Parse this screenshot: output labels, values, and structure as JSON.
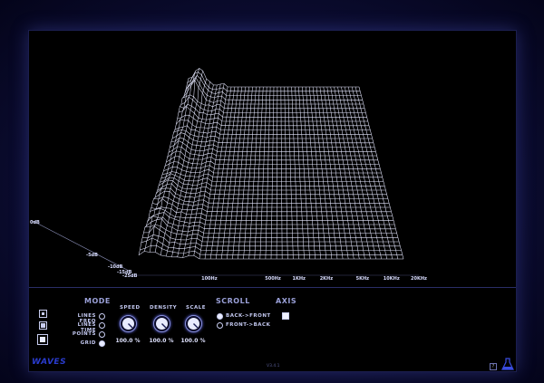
{
  "frequency_ticks": [
    {
      "label": "100Hz",
      "value": 100
    },
    {
      "label": "500Hz",
      "value": 500
    },
    {
      "label": "1KHz",
      "value": 1000
    },
    {
      "label": "2KHz",
      "value": 2000
    },
    {
      "label": "5KHz",
      "value": 5000
    },
    {
      "label": "10KHz",
      "value": 10000
    },
    {
      "label": "20KHz",
      "value": 20000
    }
  ],
  "db_ticks": [
    "0dB",
    "-5dB",
    "-10dB",
    "-15dB",
    "-25dB"
  ],
  "panel": {
    "mode_title": "MODE",
    "modes": [
      {
        "label": "LINES FREQ",
        "selected": false
      },
      {
        "label": "LINES TIME",
        "selected": false
      },
      {
        "label": "POINTS",
        "selected": false
      },
      {
        "label": "GRID",
        "selected": true
      }
    ],
    "speed": {
      "label": "SPEED",
      "value": "100.0 %"
    },
    "density": {
      "label": "DENSITY",
      "value": "100.0 %"
    },
    "scale": {
      "label": "SCALE",
      "value": "100.0 %"
    },
    "scroll_title": "SCROLL",
    "scroll_options": [
      {
        "label": "BACK->FRONT",
        "selected": true
      },
      {
        "label": "FRONT->BACK",
        "selected": false
      }
    ],
    "axis_title": "AXIS",
    "axis_checked": false
  },
  "brand": "WAVES",
  "version": "V3.4.1",
  "help_label": "?",
  "colors": {
    "wire": "#e6e8ff",
    "accent": "#2a3ccf",
    "knob": "#8890d8"
  }
}
